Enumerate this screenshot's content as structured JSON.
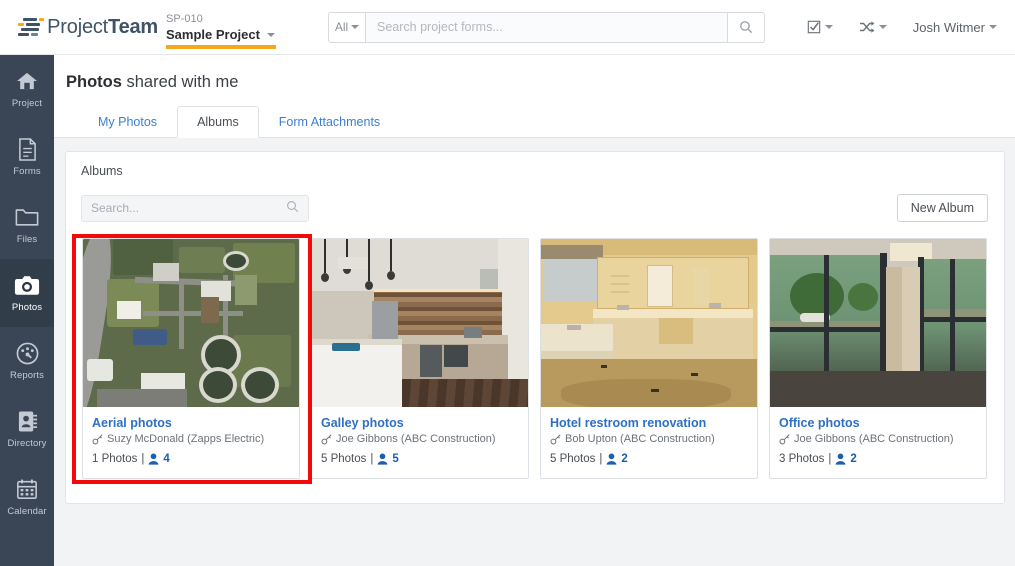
{
  "brand": {
    "name_light": "Project",
    "name_bold": "Team",
    "logo_icon": "projectteam-bars-logo"
  },
  "topbar": {
    "project_code": "SP-010",
    "project_name": "Sample Project",
    "project_caret_icon": "caret-down-icon",
    "search": {
      "scope_label": "All",
      "scope_caret_icon": "caret-down-icon",
      "placeholder": "Search project forms...",
      "value": "",
      "submit_icon": "search-icon"
    },
    "tasks_icon": "checkbox-checked-icon",
    "tasks_caret_icon": "caret-down-icon",
    "switch_icon": "shuffle-icon",
    "switch_caret_icon": "caret-down-icon",
    "user_name": "Josh Witmer",
    "user_caret_icon": "caret-down-icon"
  },
  "sidebar": {
    "items": [
      {
        "label": "Project",
        "icon": "home-icon",
        "active": false
      },
      {
        "label": "Forms",
        "icon": "document-icon",
        "active": false
      },
      {
        "label": "Files",
        "icon": "folder-icon",
        "active": false
      },
      {
        "label": "Photos",
        "icon": "camera-icon",
        "active": true
      },
      {
        "label": "Reports",
        "icon": "gauge-icon",
        "active": false
      },
      {
        "label": "Directory",
        "icon": "address-book-icon",
        "active": false
      },
      {
        "label": "Calendar",
        "icon": "calendar-icon",
        "active": false
      }
    ]
  },
  "page": {
    "title_bold": "Photos",
    "title_rest": " shared with me",
    "tabs": [
      {
        "label": "My Photos",
        "active": false
      },
      {
        "label": "Albums",
        "active": true
      },
      {
        "label": "Form Attachments",
        "active": false
      }
    ]
  },
  "panel": {
    "heading": "Albums",
    "search": {
      "placeholder": "Search...",
      "value": "",
      "icon": "search-icon"
    },
    "new_album_label": "New Album"
  },
  "albums": [
    {
      "name": "Aerial photos",
      "owner": "Suzy McDonald (Zapps Electric)",
      "owner_icon": "key-icon",
      "photo_count_label": "1 Photos",
      "separator": "|",
      "member_icon": "user-icon",
      "member_count": "4",
      "thumbnail": "aerial-wastewater-plant",
      "highlighted": true
    },
    {
      "name": "Galley photos",
      "owner": "Joe Gibbons (ABC Construction)",
      "owner_icon": "key-icon",
      "photo_count_label": "5 Photos",
      "separator": "|",
      "member_icon": "user-icon",
      "member_count": "5",
      "thumbnail": "modern-galley-kitchen",
      "highlighted": false
    },
    {
      "name": "Hotel restroom renovation",
      "owner": "Bob Upton (ABC Construction)",
      "owner_icon": "key-icon",
      "photo_count_label": "5 Photos",
      "separator": "|",
      "member_icon": "user-icon",
      "member_count": "2",
      "thumbnail": "hotel-bathroom-renovation",
      "highlighted": false
    },
    {
      "name": "Office photos",
      "owner": "Joe Gibbons (ABC Construction)",
      "owner_icon": "key-icon",
      "photo_count_label": "3 Photos",
      "separator": "|",
      "member_icon": "user-icon",
      "member_count": "2",
      "thumbnail": "corner-office-windows",
      "highlighted": false
    }
  ],
  "annotation": {
    "type": "red-highlight-rectangle",
    "color": "#f20a0a",
    "targets": "first-album-card"
  },
  "colors": {
    "accent_orange": "#f5a81c",
    "link_blue": "#2f6fc4",
    "sidebar_bg": "#3a4655",
    "tab_link": "#3a7fd5"
  }
}
